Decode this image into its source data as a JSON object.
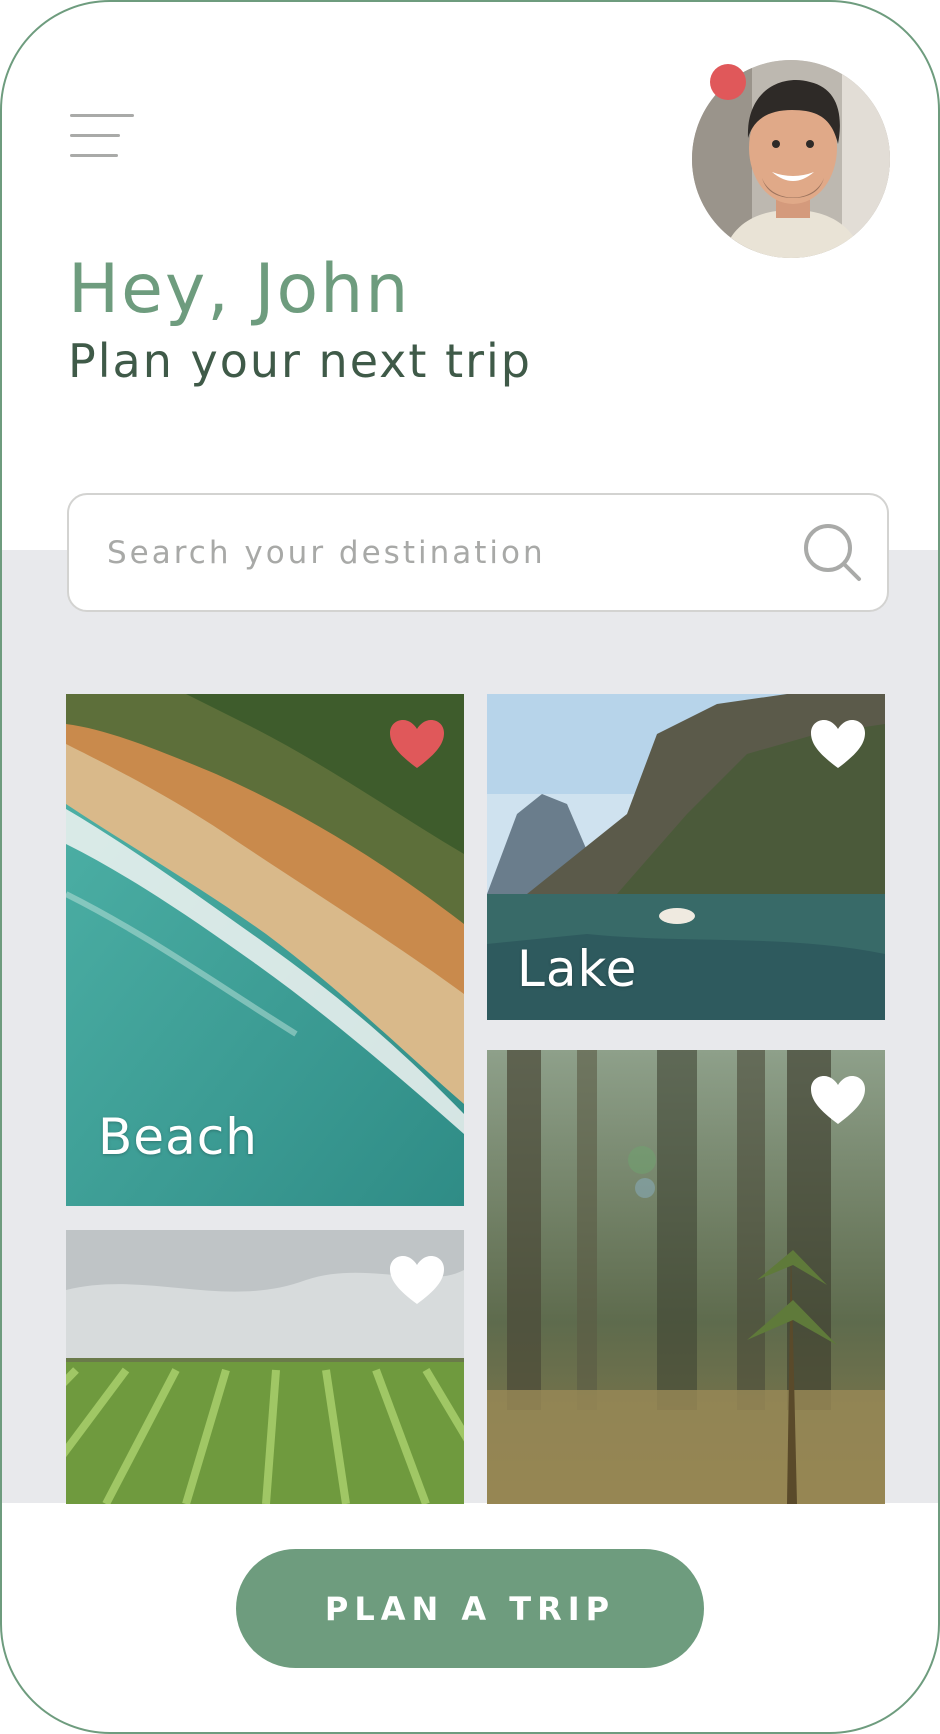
{
  "header": {
    "greeting": "Hey, John",
    "subtitle": "Plan your next trip",
    "menu_icon": "hamburger-menu-icon",
    "avatar_icon": "user-avatar",
    "has_notification": true
  },
  "search": {
    "placeholder": "Search your destination",
    "value": "",
    "icon": "search-icon"
  },
  "destinations": [
    {
      "label": "Beach",
      "favorited": true
    },
    {
      "label": "Lake",
      "favorited": false
    },
    {
      "label": "",
      "favorited": false
    },
    {
      "label": "",
      "favorited": false
    }
  ],
  "cta": {
    "label": "PLAN A TRIP"
  },
  "colors": {
    "brand_green": "#6e9c7e",
    "dark_green": "#3f5a48",
    "heart_active": "#e0585a",
    "heart_inactive": "#ffffff",
    "band_gray": "#e8e9ec"
  }
}
